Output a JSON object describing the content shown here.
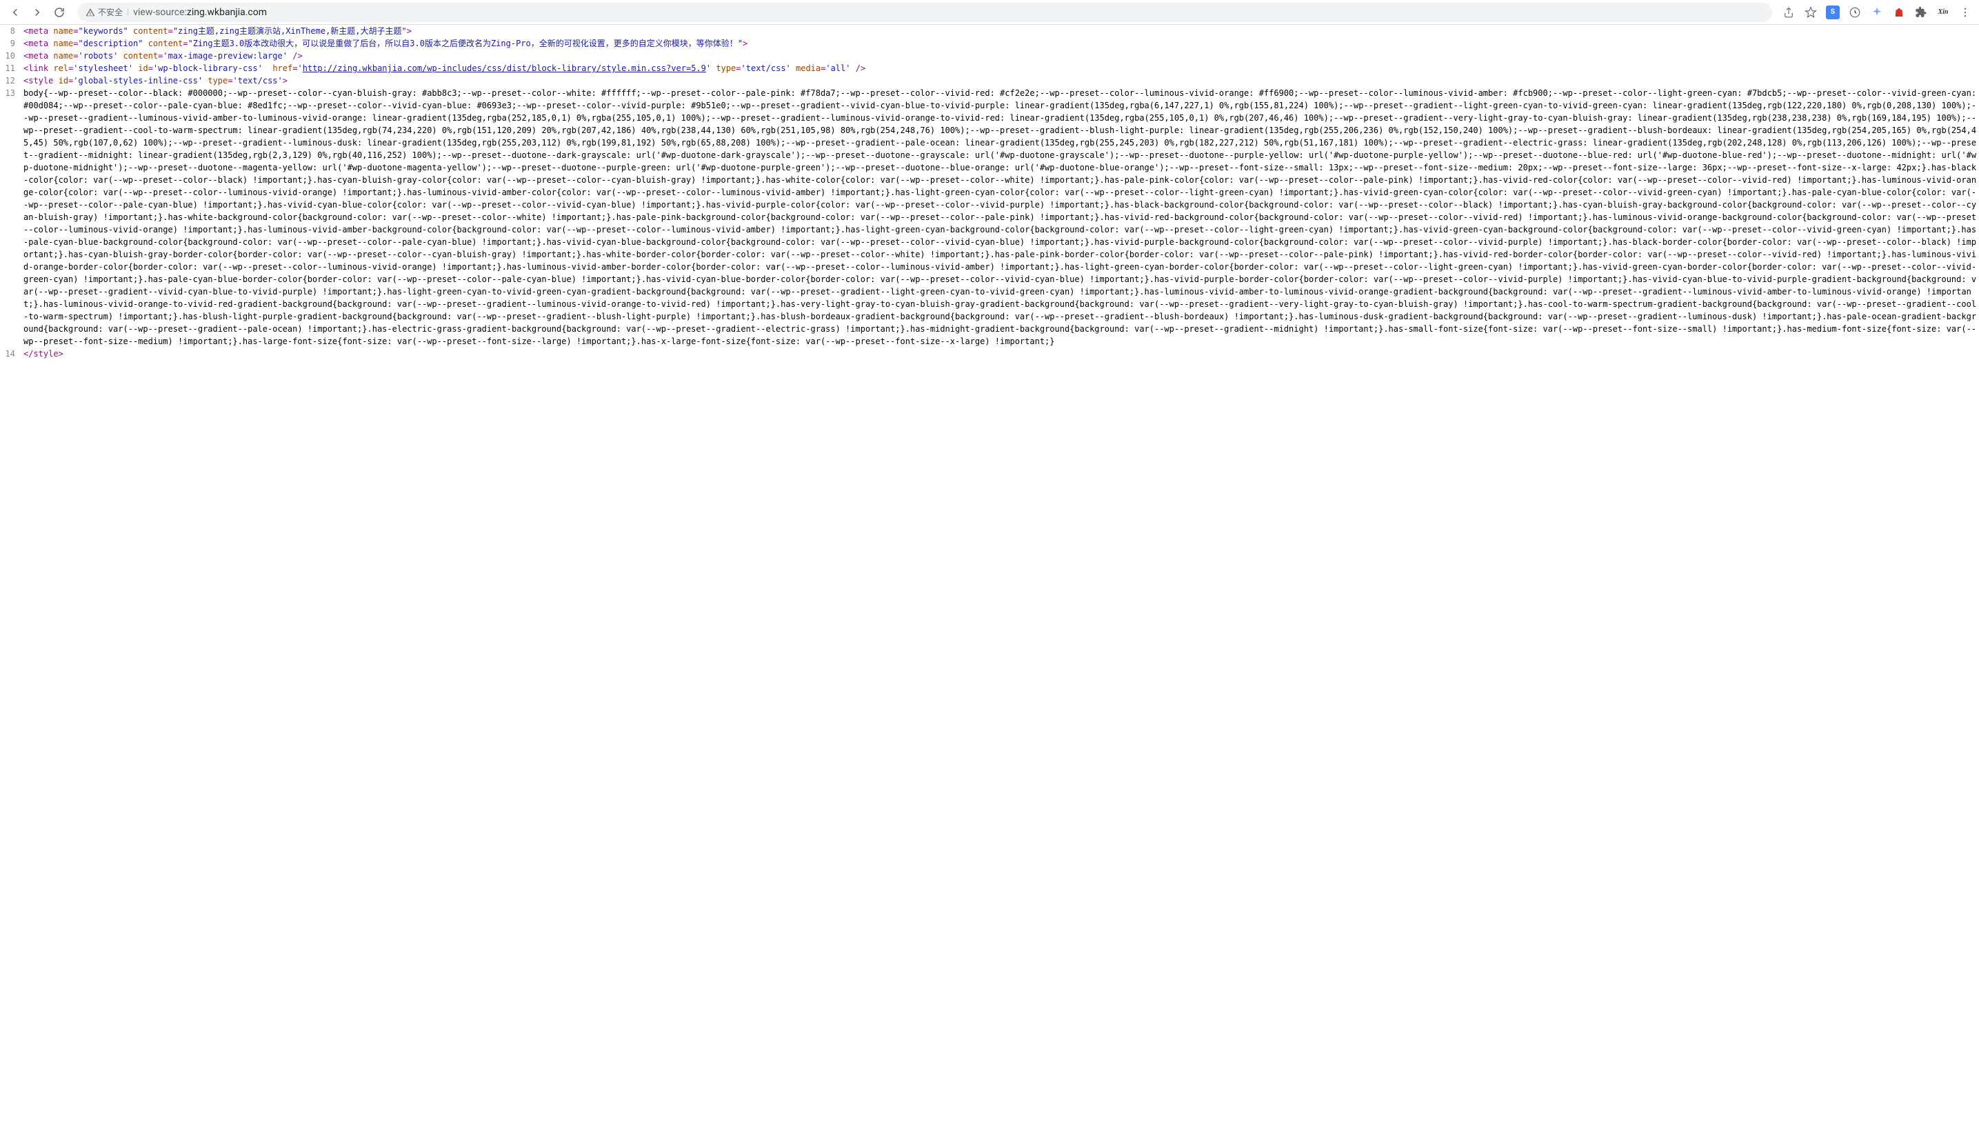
{
  "toolbar": {
    "security_text": "不安全",
    "url_scheme": "view-source:",
    "url_host": "zing.wkbanjia.com"
  },
  "lines": [
    {
      "n": 8,
      "tokens": [
        {
          "c": "t-punc",
          "t": "<"
        },
        {
          "c": "t-tag",
          "t": "meta"
        },
        {
          "c": "",
          "t": " "
        },
        {
          "c": "t-attr",
          "t": "name"
        },
        {
          "c": "t-punc",
          "t": "="
        },
        {
          "c": "t-val",
          "t": "\"keywords\""
        },
        {
          "c": "",
          "t": " "
        },
        {
          "c": "t-attr",
          "t": "content"
        },
        {
          "c": "t-punc",
          "t": "="
        },
        {
          "c": "t-val",
          "t": "\"zing主题,zing主题演示站,XinTheme,新主题,大胡子主题\""
        },
        {
          "c": "t-punc",
          "t": ">"
        }
      ]
    },
    {
      "n": 9,
      "tokens": [
        {
          "c": "t-punc",
          "t": "<"
        },
        {
          "c": "t-tag",
          "t": "meta"
        },
        {
          "c": "",
          "t": " "
        },
        {
          "c": "t-attr",
          "t": "name"
        },
        {
          "c": "t-punc",
          "t": "="
        },
        {
          "c": "t-val",
          "t": "\"description\""
        },
        {
          "c": "",
          "t": " "
        },
        {
          "c": "t-attr",
          "t": "content"
        },
        {
          "c": "t-punc",
          "t": "="
        },
        {
          "c": "t-val",
          "t": "\"Zing主题3.0版本改动很大，可以说是重做了后台，所以自3.0版本之后便改名为Zing-Pro，全新的可视化设置，更多的自定义你模块，等你体验！\""
        },
        {
          "c": "t-punc",
          "t": ">"
        }
      ]
    },
    {
      "n": 10,
      "tokens": [
        {
          "c": "t-punc",
          "t": "<"
        },
        {
          "c": "t-tag",
          "t": "meta"
        },
        {
          "c": "",
          "t": " "
        },
        {
          "c": "t-attr",
          "t": "name"
        },
        {
          "c": "t-punc",
          "t": "="
        },
        {
          "c": "t-val",
          "t": "'robots'"
        },
        {
          "c": "",
          "t": " "
        },
        {
          "c": "t-attr",
          "t": "content"
        },
        {
          "c": "t-punc",
          "t": "="
        },
        {
          "c": "t-val",
          "t": "'max-image-preview:large'"
        },
        {
          "c": "",
          "t": " "
        },
        {
          "c": "t-punc",
          "t": "/>"
        }
      ]
    },
    {
      "n": 11,
      "tokens": [
        {
          "c": "t-punc",
          "t": "<"
        },
        {
          "c": "t-tag",
          "t": "link"
        },
        {
          "c": "",
          "t": " "
        },
        {
          "c": "t-attr",
          "t": "rel"
        },
        {
          "c": "t-punc",
          "t": "="
        },
        {
          "c": "t-val",
          "t": "'stylesheet'"
        },
        {
          "c": "",
          "t": " "
        },
        {
          "c": "t-attr",
          "t": "id"
        },
        {
          "c": "t-punc",
          "t": "="
        },
        {
          "c": "t-val",
          "t": "'wp-block-library-css'"
        },
        {
          "c": "",
          "t": "  "
        },
        {
          "c": "t-attr",
          "t": "href"
        },
        {
          "c": "t-punc",
          "t": "="
        },
        {
          "c": "t-val",
          "t": "'"
        },
        {
          "c": "t-link",
          "t": "http://zing.wkbanjia.com/wp-includes/css/dist/block-library/style.min.css?ver=5.9"
        },
        {
          "c": "t-val",
          "t": "'"
        },
        {
          "c": "",
          "t": " "
        },
        {
          "c": "t-attr",
          "t": "type"
        },
        {
          "c": "t-punc",
          "t": "="
        },
        {
          "c": "t-val",
          "t": "'text/css'"
        },
        {
          "c": "",
          "t": " "
        },
        {
          "c": "t-attr",
          "t": "media"
        },
        {
          "c": "t-punc",
          "t": "="
        },
        {
          "c": "t-val",
          "t": "'all'"
        },
        {
          "c": "",
          "t": " "
        },
        {
          "c": "t-punc",
          "t": "/>"
        }
      ]
    },
    {
      "n": 12,
      "tokens": [
        {
          "c": "t-punc",
          "t": "<"
        },
        {
          "c": "t-tag",
          "t": "style"
        },
        {
          "c": "",
          "t": " "
        },
        {
          "c": "t-attr",
          "t": "id"
        },
        {
          "c": "t-punc",
          "t": "="
        },
        {
          "c": "t-val",
          "t": "'global-styles-inline-css'"
        },
        {
          "c": "",
          "t": " "
        },
        {
          "c": "t-attr",
          "t": "type"
        },
        {
          "c": "t-punc",
          "t": "="
        },
        {
          "c": "t-val",
          "t": "'text/css'"
        },
        {
          "c": "t-punc",
          "t": ">"
        }
      ]
    },
    {
      "n": 13,
      "tokens": [
        {
          "c": "t-text",
          "t": "body{--wp--preset--color--black: #000000;--wp--preset--color--cyan-bluish-gray: #abb8c3;--wp--preset--color--white: #ffffff;--wp--preset--color--pale-pink: #f78da7;--wp--preset--color--vivid-red: #cf2e2e;--wp--preset--color--luminous-vivid-orange: #ff6900;--wp--preset--color--luminous-vivid-amber: #fcb900;--wp--preset--color--light-green-cyan: #7bdcb5;--wp--preset--color--vivid-green-cyan: #00d084;--wp--preset--color--pale-cyan-blue: #8ed1fc;--wp--preset--color--vivid-cyan-blue: #0693e3;--wp--preset--color--vivid-purple: #9b51e0;--wp--preset--gradient--vivid-cyan-blue-to-vivid-purple: linear-gradient(135deg,rgba(6,147,227,1) 0%,rgb(155,81,224) 100%);--wp--preset--gradient--light-green-cyan-to-vivid-green-cyan: linear-gradient(135deg,rgb(122,220,180) 0%,rgb(0,208,130) 100%);--wp--preset--gradient--luminous-vivid-amber-to-luminous-vivid-orange: linear-gradient(135deg,rgba(252,185,0,1) 0%,rgba(255,105,0,1) 100%);--wp--preset--gradient--luminous-vivid-orange-to-vivid-red: linear-gradient(135deg,rgba(255,105,0,1) 0%,rgb(207,46,46) 100%);--wp--preset--gradient--very-light-gray-to-cyan-bluish-gray: linear-gradient(135deg,rgb(238,238,238) 0%,rgb(169,184,195) 100%);--wp--preset--gradient--cool-to-warm-spectrum: linear-gradient(135deg,rgb(74,234,220) 0%,rgb(151,120,209) 20%,rgb(207,42,186) 40%,rgb(238,44,130) 60%,rgb(251,105,98) 80%,rgb(254,248,76) 100%);--wp--preset--gradient--blush-light-purple: linear-gradient(135deg,rgb(255,206,236) 0%,rgb(152,150,240) 100%);--wp--preset--gradient--blush-bordeaux: linear-gradient(135deg,rgb(254,205,165) 0%,rgb(254,45,45) 50%,rgb(107,0,62) 100%);--wp--preset--gradient--luminous-dusk: linear-gradient(135deg,rgb(255,203,112) 0%,rgb(199,81,192) 50%,rgb(65,88,208) 100%);--wp--preset--gradient--pale-ocean: linear-gradient(135deg,rgb(255,245,203) 0%,rgb(182,227,212) 50%,rgb(51,167,181) 100%);--wp--preset--gradient--electric-grass: linear-gradient(135deg,rgb(202,248,128) 0%,rgb(113,206,126) 100%);--wp--preset--gradient--midnight: linear-gradient(135deg,rgb(2,3,129) 0%,rgb(40,116,252) 100%);--wp--preset--duotone--dark-grayscale: url('#wp-duotone-dark-grayscale');--wp--preset--duotone--grayscale: url('#wp-duotone-grayscale');--wp--preset--duotone--purple-yellow: url('#wp-duotone-purple-yellow');--wp--preset--duotone--blue-red: url('#wp-duotone-blue-red');--wp--preset--duotone--midnight: url('#wp-duotone-midnight');--wp--preset--duotone--magenta-yellow: url('#wp-duotone-magenta-yellow');--wp--preset--duotone--purple-green: url('#wp-duotone-purple-green');--wp--preset--duotone--blue-orange: url('#wp-duotone-blue-orange');--wp--preset--font-size--small: 13px;--wp--preset--font-size--medium: 20px;--wp--preset--font-size--large: 36px;--wp--preset--font-size--x-large: 42px;}.has-black-color{color: var(--wp--preset--color--black) !important;}.has-cyan-bluish-gray-color{color: var(--wp--preset--color--cyan-bluish-gray) !important;}.has-white-color{color: var(--wp--preset--color--white) !important;}.has-pale-pink-color{color: var(--wp--preset--color--pale-pink) !important;}.has-vivid-red-color{color: var(--wp--preset--color--vivid-red) !important;}.has-luminous-vivid-orange-color{color: var(--wp--preset--color--luminous-vivid-orange) !important;}.has-luminous-vivid-amber-color{color: var(--wp--preset--color--luminous-vivid-amber) !important;}.has-light-green-cyan-color{color: var(--wp--preset--color--light-green-cyan) !important;}.has-vivid-green-cyan-color{color: var(--wp--preset--color--vivid-green-cyan) !important;}.has-pale-cyan-blue-color{color: var(--wp--preset--color--pale-cyan-blue) !important;}.has-vivid-cyan-blue-color{color: var(--wp--preset--color--vivid-cyan-blue) !important;}.has-vivid-purple-color{color: var(--wp--preset--color--vivid-purple) !important;}.has-black-background-color{background-color: var(--wp--preset--color--black) !important;}.has-cyan-bluish-gray-background-color{background-color: var(--wp--preset--color--cyan-bluish-gray) !important;}.has-white-background-color{background-color: var(--wp--preset--color--white) !important;}.has-pale-pink-background-color{background-color: var(--wp--preset--color--pale-pink) !important;}.has-vivid-red-background-color{background-color: var(--wp--preset--color--vivid-red) !important;}.has-luminous-vivid-orange-background-color{background-color: var(--wp--preset--color--luminous-vivid-orange) !important;}.has-luminous-vivid-amber-background-color{background-color: var(--wp--preset--color--luminous-vivid-amber) !important;}.has-light-green-cyan-background-color{background-color: var(--wp--preset--color--light-green-cyan) !important;}.has-vivid-green-cyan-background-color{background-color: var(--wp--preset--color--vivid-green-cyan) !important;}.has-pale-cyan-blue-background-color{background-color: var(--wp--preset--color--pale-cyan-blue) !important;}.has-vivid-cyan-blue-background-color{background-color: var(--wp--preset--color--vivid-cyan-blue) !important;}.has-vivid-purple-background-color{background-color: var(--wp--preset--color--vivid-purple) !important;}.has-black-border-color{border-color: var(--wp--preset--color--black) !important;}.has-cyan-bluish-gray-border-color{border-color: var(--wp--preset--color--cyan-bluish-gray) !important;}.has-white-border-color{border-color: var(--wp--preset--color--white) !important;}.has-pale-pink-border-color{border-color: var(--wp--preset--color--pale-pink) !important;}.has-vivid-red-border-color{border-color: var(--wp--preset--color--vivid-red) !important;}.has-luminous-vivid-orange-border-color{border-color: var(--wp--preset--color--luminous-vivid-orange) !important;}.has-luminous-vivid-amber-border-color{border-color: var(--wp--preset--color--luminous-vivid-amber) !important;}.has-light-green-cyan-border-color{border-color: var(--wp--preset--color--light-green-cyan) !important;}.has-vivid-green-cyan-border-color{border-color: var(--wp--preset--color--vivid-green-cyan) !important;}.has-pale-cyan-blue-border-color{border-color: var(--wp--preset--color--pale-cyan-blue) !important;}.has-vivid-cyan-blue-border-color{border-color: var(--wp--preset--color--vivid-cyan-blue) !important;}.has-vivid-purple-border-color{border-color: var(--wp--preset--color--vivid-purple) !important;}.has-vivid-cyan-blue-to-vivid-purple-gradient-background{background: var(--wp--preset--gradient--vivid-cyan-blue-to-vivid-purple) !important;}.has-light-green-cyan-to-vivid-green-cyan-gradient-background{background: var(--wp--preset--gradient--light-green-cyan-to-vivid-green-cyan) !important;}.has-luminous-vivid-amber-to-luminous-vivid-orange-gradient-background{background: var(--wp--preset--gradient--luminous-vivid-amber-to-luminous-vivid-orange) !important;}.has-luminous-vivid-orange-to-vivid-red-gradient-background{background: var(--wp--preset--gradient--luminous-vivid-orange-to-vivid-red) !important;}.has-very-light-gray-to-cyan-bluish-gray-gradient-background{background: var(--wp--preset--gradient--very-light-gray-to-cyan-bluish-gray) !important;}.has-cool-to-warm-spectrum-gradient-background{background: var(--wp--preset--gradient--cool-to-warm-spectrum) !important;}.has-blush-light-purple-gradient-background{background: var(--wp--preset--gradient--blush-light-purple) !important;}.has-blush-bordeaux-gradient-background{background: var(--wp--preset--gradient--blush-bordeaux) !important;}.has-luminous-dusk-gradient-background{background: var(--wp--preset--gradient--luminous-dusk) !important;}.has-pale-ocean-gradient-background{background: var(--wp--preset--gradient--pale-ocean) !important;}.has-electric-grass-gradient-background{background: var(--wp--preset--gradient--electric-grass) !important;}.has-midnight-gradient-background{background: var(--wp--preset--gradient--midnight) !important;}.has-small-font-size{font-size: var(--wp--preset--font-size--small) !important;}.has-medium-font-size{font-size: var(--wp--preset--font-size--medium) !important;}.has-large-font-size{font-size: var(--wp--preset--font-size--large) !important;}.has-x-large-font-size{font-size: var(--wp--preset--font-size--x-large) !important;}"
        }
      ]
    },
    {
      "n": 14,
      "tokens": [
        {
          "c": "t-punc",
          "t": "</"
        },
        {
          "c": "t-tag",
          "t": "style"
        },
        {
          "c": "t-punc",
          "t": ">"
        }
      ]
    }
  ]
}
